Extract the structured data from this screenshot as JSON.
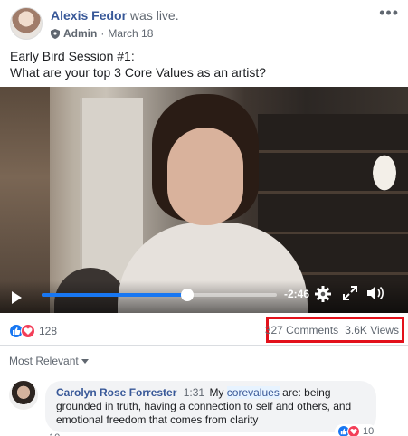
{
  "post": {
    "author_name": "Alexis Fedor",
    "author_action": "was live.",
    "role": "Admin",
    "separator": "·",
    "date": "March 18",
    "more_label": "•••",
    "text_line1": "Early Bird Session #1:",
    "text_line2": "What are your top 3 Core Values as an artist?"
  },
  "video": {
    "time_left": "-2:46",
    "progress": 0.62
  },
  "stats": {
    "reaction_count": "128",
    "comments": "327 Comments",
    "views": "3.6K Views"
  },
  "comments": {
    "sort_label": "Most Relevant",
    "first": {
      "author": "Carolyn Rose Forrester",
      "time": "1:31",
      "text_before": "My",
      "hashtag": "corevalues",
      "text_after": "are: being grounded in truth, having a connection to self and others, and emotional freedom that comes from clarity",
      "reaction_count": "10",
      "partial_text": "10"
    }
  },
  "colors": {
    "link": "#385898",
    "like": "#1877f2",
    "love": "#f33e58",
    "highlight_box": "#e3111b"
  }
}
